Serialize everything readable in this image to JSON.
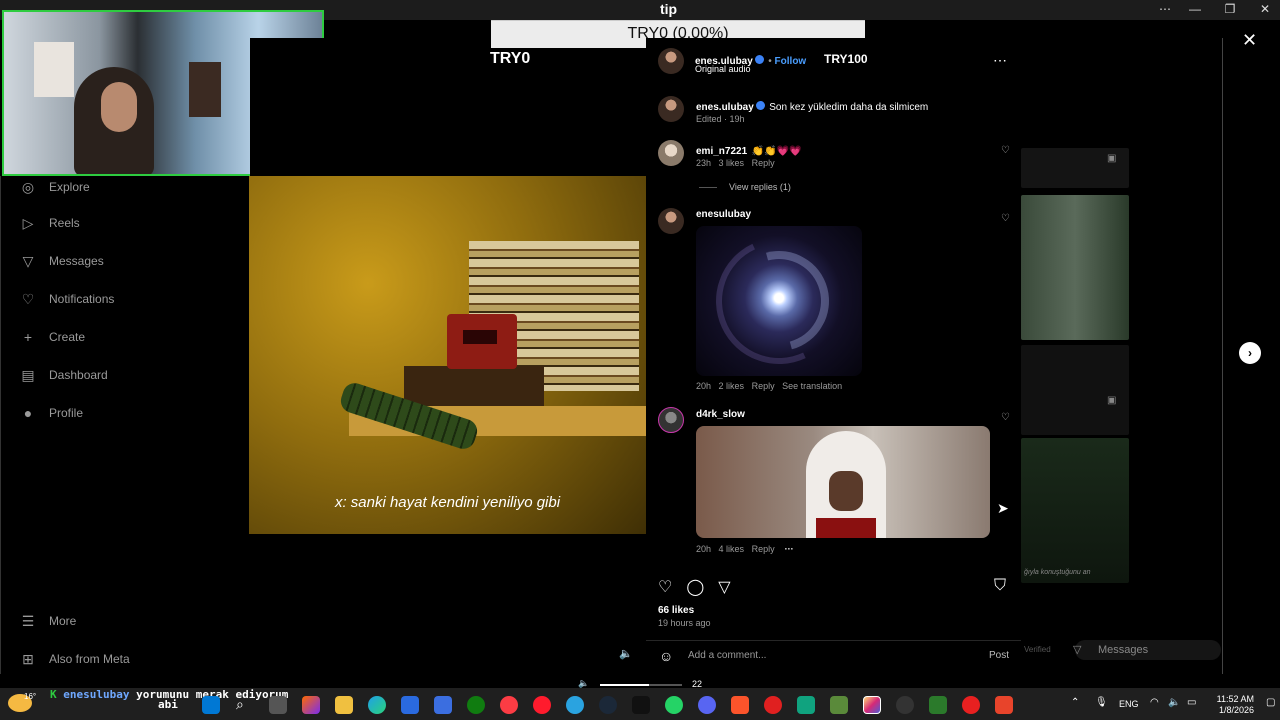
{
  "window": {
    "title": "tip"
  },
  "overlay": {
    "tip_bar": "TRY0 (0.00%)",
    "try0": "TRY0",
    "try100": "TRY100"
  },
  "sidebar": {
    "items": [
      {
        "label": "Explore",
        "icon": "compass-icon"
      },
      {
        "label": "Reels",
        "icon": "reels-icon"
      },
      {
        "label": "Messages",
        "icon": "messages-icon"
      },
      {
        "label": "Notifications",
        "icon": "heart-icon"
      },
      {
        "label": "Create",
        "icon": "plus-icon"
      },
      {
        "label": "Dashboard",
        "icon": "dashboard-icon"
      },
      {
        "label": "Profile",
        "icon": "avatar"
      }
    ],
    "bottom": [
      {
        "label": "More",
        "icon": "menu-icon"
      },
      {
        "label": "Also from Meta",
        "icon": "grid-icon"
      }
    ]
  },
  "video": {
    "caption": "x: sanki hayat kendini yeniliyo gibi"
  },
  "post": {
    "author": "enes.ulubay",
    "follow": "Follow",
    "audio": "Original audio",
    "caption_author": "enes.ulubay",
    "caption_text": "Son kez yükledim daha da silmicem",
    "caption_meta": "Edited · 19h",
    "comments": [
      {
        "user": "emi_n7221",
        "text": "👏👏💗💗",
        "time": "23h",
        "likes": "3 likes",
        "reply": "Reply",
        "view_replies": "View replies (1)"
      },
      {
        "user": "enesulubay",
        "time": "20h",
        "likes": "2 likes",
        "reply": "Reply",
        "translate": "See translation"
      },
      {
        "user": "d4rk_slow",
        "time": "20h",
        "likes": "4 likes",
        "reply": "Reply",
        "more": "···"
      }
    ],
    "likes": "66 likes",
    "posted": "19 hours ago",
    "comment_placeholder": "Add a comment...",
    "post_button": "Post"
  },
  "right": {
    "messages": "Messages",
    "verified": "Verified",
    "caption_fragment": "ğıyla konuştuğunu an"
  },
  "stream": {
    "ticker_user": "enesulubay",
    "ticker_line1": "yorumunu merak ediyorum",
    "ticker_line2": "abi",
    "volume": "22"
  },
  "taskbar": {
    "temp": "16°",
    "lang": "ENG",
    "time": "11:52 AM",
    "date": "1/8/2026"
  }
}
